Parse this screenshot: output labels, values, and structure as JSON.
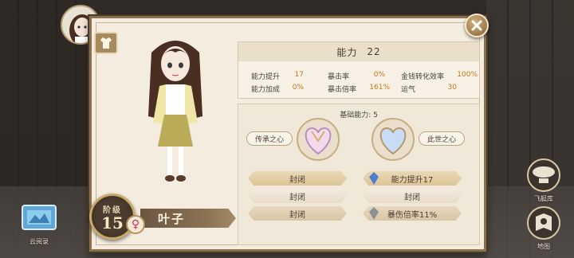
{
  "side": {
    "left_icon_label": "云阅录",
    "right_icon_1_label": "飞艇库",
    "right_icon_2_label": "地图"
  },
  "stats": {
    "title": "能力",
    "total": "22",
    "rows": [
      {
        "label": "能力提升",
        "value": "17"
      },
      {
        "label": "暴击率",
        "value": "0%"
      },
      {
        "label": "金钱转化效率",
        "value": "100%"
      },
      {
        "label": "能力加成",
        "value": "0%"
      },
      {
        "label": "暴击倍率",
        "value": "161%"
      },
      {
        "label": "运气",
        "value": "30"
      }
    ]
  },
  "ability": {
    "basic_label": "基础能力: 5",
    "left_slot": "传承之心",
    "right_slot": "此世之心",
    "left_rows": [
      "封闭",
      "封闭",
      "封闭"
    ],
    "right_rows": [
      "能力提升17",
      "封闭",
      "暴伤倍率11%"
    ]
  },
  "character": {
    "rank_label": "阶级",
    "rank_value": "15",
    "gender_symbol": "♀",
    "name": "叶子"
  },
  "colors": {
    "panel_bg": "#f3ecdf",
    "accent_value": "#c47a1e",
    "gender": "#c2336b"
  }
}
